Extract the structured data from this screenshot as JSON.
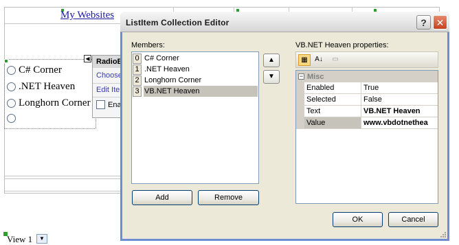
{
  "designer": {
    "link_text": "My Websites",
    "radio_items": [
      {
        "label": "C# Corner"
      },
      {
        "label": ".NET Heaven"
      },
      {
        "label": "Longhorn Corner"
      },
      {
        "label": ""
      }
    ],
    "tasks_panel": {
      "title": "RadioB",
      "choose_link": "Choose",
      "edit_link": "Edit Ite",
      "enable_label": "Ena",
      "smart_tag_icon": "triangle-left-icon"
    },
    "view_selector": {
      "value": "View 1"
    }
  },
  "dialog": {
    "title": "ListItem Collection Editor",
    "help_glyph": "?",
    "close_glyph": "✕",
    "members_label": "Members:",
    "members": [
      {
        "index": "0",
        "text": "C# Corner",
        "selected": false
      },
      {
        "index": "1",
        "text": ".NET Heaven",
        "selected": false
      },
      {
        "index": "2",
        "text": "Longhorn Corner",
        "selected": false
      },
      {
        "index": "3",
        "text": "VB.NET Heaven",
        "selected": true
      }
    ],
    "move_up_icon": "arrow-up-icon",
    "move_down_icon": "arrow-down-icon",
    "add_label": "Add",
    "remove_label": "Remove",
    "properties_label": "VB.NET Heaven properties:",
    "toolbar_tools": [
      "categorized-icon",
      "alphabetical-icon",
      "property-pages-icon"
    ],
    "category": {
      "name": "Misc",
      "expanded": true
    },
    "properties": [
      {
        "name": "Enabled",
        "value": "True",
        "bold": false,
        "selected": false
      },
      {
        "name": "Selected",
        "value": "False",
        "bold": false,
        "selected": false
      },
      {
        "name": "Text",
        "value": "VB.NET Heaven",
        "bold": true,
        "selected": false
      },
      {
        "name": "Value",
        "value": "www.vbdotnethea",
        "bold": true,
        "selected": true
      }
    ],
    "ok_label": "OK",
    "cancel_label": "Cancel"
  },
  "colors": {
    "title_bar_border": "#6d8dd1",
    "dialog_face": "#ece9d8",
    "selection": "#c6c3bb",
    "link": "#1a1aa6"
  }
}
